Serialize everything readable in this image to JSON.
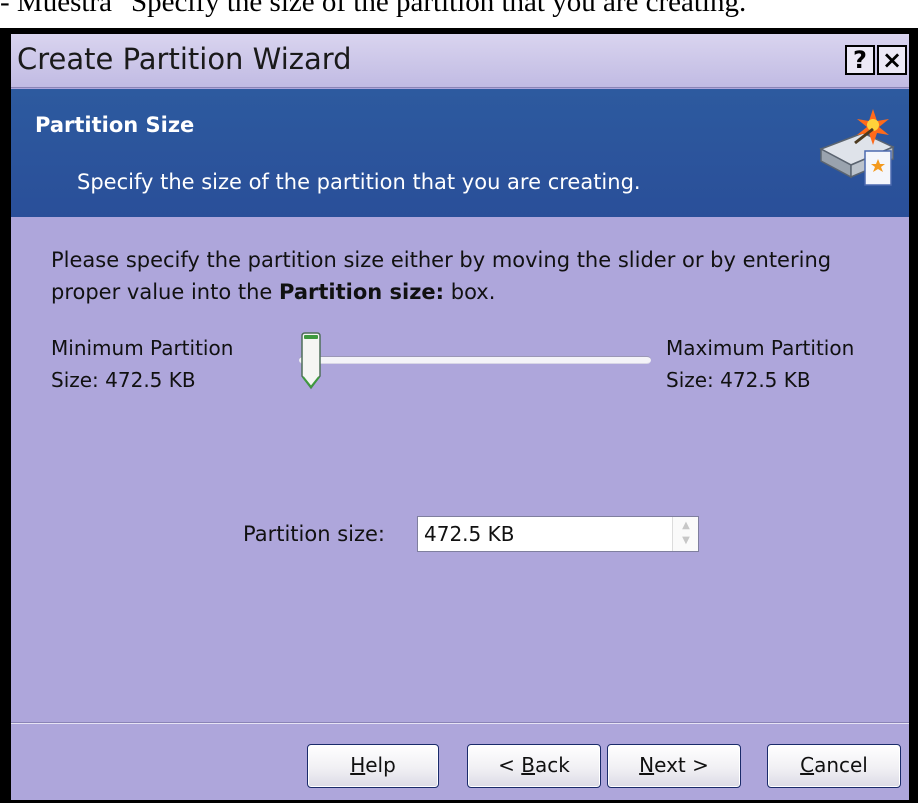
{
  "caption": {
    "text": "- Muestra \"Specify the size of the partition that you are creating.\""
  },
  "window": {
    "title": "Create Partition Wizard",
    "help_glyph": "?",
    "close_glyph": "×"
  },
  "header": {
    "title": "Partition Size",
    "subtitle": "Specify the size of the partition that you are creating."
  },
  "body": {
    "instruction_part1": "Please specify the partition size either by moving the slider or by entering proper value into the ",
    "instruction_bold": "Partition size:",
    "instruction_part2": " box."
  },
  "slider": {
    "min_label_line1": "Minimum Partition",
    "min_label_line2": "Size: 472.5 KB",
    "max_label_line1": "Maximum Partition",
    "max_label_line2": "Size: 472.5 KB",
    "value_fraction": 0
  },
  "size_field": {
    "label": "Partition size:",
    "value": "472.5 KB"
  },
  "buttons": {
    "help": {
      "accel": "H",
      "rest": "elp"
    },
    "back": {
      "prefix": "< ",
      "accel": "B",
      "rest": "ack"
    },
    "next": {
      "accel": "N",
      "rest": "ext >"
    },
    "cancel": {
      "accel": "C",
      "rest": "ancel"
    }
  },
  "colors": {
    "dialog_background": "#aea6db",
    "header_band": "#2a4f99",
    "accent_green": "#3f9a3f"
  }
}
